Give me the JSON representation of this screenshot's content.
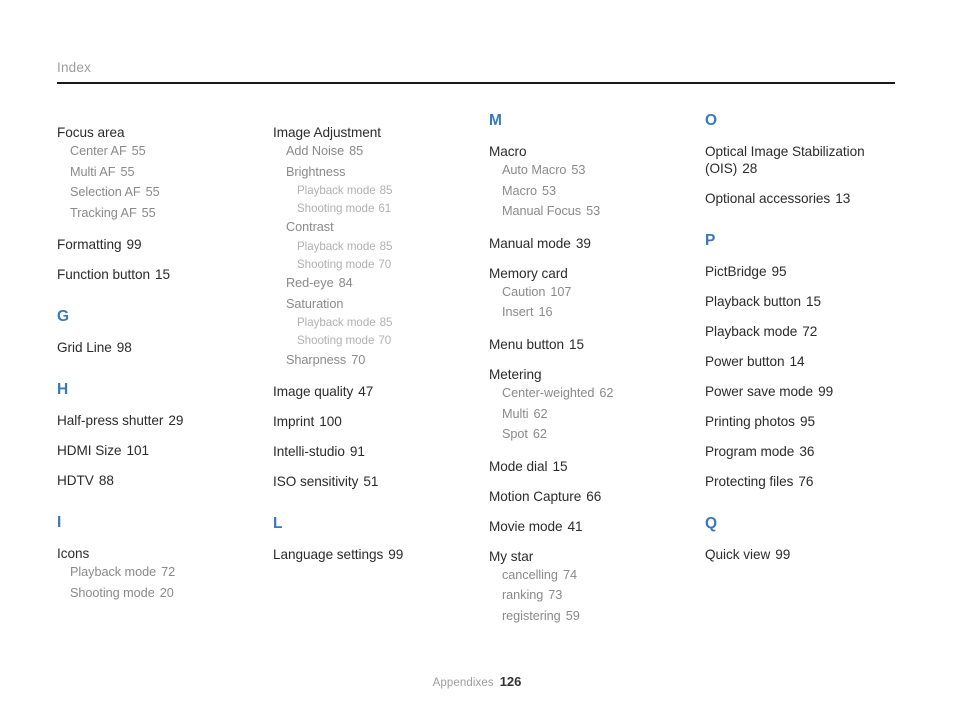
{
  "header": {
    "title": "Index"
  },
  "footer": {
    "label": "Appendixes",
    "page": "126"
  },
  "colors": {
    "section_letter": "#3878c0",
    "level1_text": "#2b2b2b",
    "level2_text": "#8a8a8a",
    "level3_text": "#b1b1b1",
    "header_text": "#9d9d9d",
    "rule": "#1a1a1a",
    "background": "#ffffff"
  },
  "columns": [
    {
      "blocks": [
        {
          "type": "group",
          "term": "Focus area",
          "page": "",
          "children": [
            {
              "term": "Center AF",
              "page": "55"
            },
            {
              "term": "Multi AF",
              "page": "55"
            },
            {
              "term": "Selection AF",
              "page": "55"
            },
            {
              "term": "Tracking AF",
              "page": "55"
            }
          ]
        },
        {
          "type": "entry",
          "term": "Formatting",
          "page": "99"
        },
        {
          "type": "entry",
          "term": "Function button",
          "page": "15"
        },
        {
          "type": "letter",
          "letter": "G"
        },
        {
          "type": "entry",
          "term": "Grid Line",
          "page": "98"
        },
        {
          "type": "letter",
          "letter": "H"
        },
        {
          "type": "entry",
          "term": "Half-press shutter",
          "page": "29"
        },
        {
          "type": "entry",
          "term": "HDMI Size",
          "page": "101"
        },
        {
          "type": "entry",
          "term": "HDTV",
          "page": "88"
        },
        {
          "type": "letter",
          "letter": "I"
        },
        {
          "type": "group",
          "term": "Icons",
          "page": "",
          "children": [
            {
              "term": "Playback mode",
              "page": "72"
            },
            {
              "term": "Shooting mode",
              "page": "20"
            }
          ]
        }
      ]
    },
    {
      "blocks": [
        {
          "type": "group",
          "term": "Image Adjustment",
          "page": "",
          "children": [
            {
              "term": "Add Noise",
              "page": "85"
            },
            {
              "term": "Brightness",
              "page": "",
              "children": [
                {
                  "term": "Playback mode",
                  "page": "85"
                },
                {
                  "term": "Shooting mode",
                  "page": "61"
                }
              ]
            },
            {
              "term": "Contrast",
              "page": "",
              "children": [
                {
                  "term": "Playback mode",
                  "page": "85"
                },
                {
                  "term": "Shooting mode",
                  "page": "70"
                }
              ]
            },
            {
              "term": "Red-eye",
              "page": "84"
            },
            {
              "term": "Saturation",
              "page": "",
              "children": [
                {
                  "term": "Playback mode",
                  "page": "85"
                },
                {
                  "term": "Shooting mode",
                  "page": "70"
                }
              ]
            },
            {
              "term": "Sharpness",
              "page": "70"
            }
          ]
        },
        {
          "type": "entry",
          "term": "Image quality",
          "page": "47"
        },
        {
          "type": "entry",
          "term": "Imprint",
          "page": "100"
        },
        {
          "type": "entry",
          "term": "Intelli-studio",
          "page": "91"
        },
        {
          "type": "entry",
          "term": "ISO sensitivity",
          "page": "51"
        },
        {
          "type": "letter",
          "letter": "L"
        },
        {
          "type": "entry",
          "term": "Language settings",
          "page": "99"
        }
      ]
    },
    {
      "blocks": [
        {
          "type": "letter",
          "letter": "M"
        },
        {
          "type": "group",
          "term": "Macro",
          "page": "",
          "children": [
            {
              "term": "Auto Macro",
              "page": "53"
            },
            {
              "term": "Macro",
              "page": "53"
            },
            {
              "term": "Manual Focus",
              "page": "53"
            }
          ]
        },
        {
          "type": "entry",
          "term": "Manual mode",
          "page": "39"
        },
        {
          "type": "group",
          "term": "Memory card",
          "page": "",
          "children": [
            {
              "term": "Caution",
              "page": "107"
            },
            {
              "term": "Insert",
              "page": "16"
            }
          ]
        },
        {
          "type": "entry",
          "term": "Menu button",
          "page": "15"
        },
        {
          "type": "group",
          "term": "Metering",
          "page": "",
          "children": [
            {
              "term": "Center-weighted",
              "page": "62"
            },
            {
              "term": "Multi",
              "page": "62"
            },
            {
              "term": "Spot",
              "page": "62"
            }
          ]
        },
        {
          "type": "entry",
          "term": "Mode dial",
          "page": "15"
        },
        {
          "type": "entry",
          "term": "Motion Capture",
          "page": "66"
        },
        {
          "type": "entry",
          "term": "Movie mode",
          "page": "41"
        },
        {
          "type": "group",
          "term": "My star",
          "page": "",
          "children": [
            {
              "term": "cancelling",
              "page": "74"
            },
            {
              "term": "ranking",
              "page": "73"
            },
            {
              "term": "registering",
              "page": "59"
            }
          ]
        }
      ]
    },
    {
      "blocks": [
        {
          "type": "letter",
          "letter": "O"
        },
        {
          "type": "entry",
          "term": "Optical Image Stabilization (OIS)",
          "page": "28"
        },
        {
          "type": "entry",
          "term": "Optional accessories",
          "page": "13"
        },
        {
          "type": "letter",
          "letter": "P"
        },
        {
          "type": "entry",
          "term": "PictBridge",
          "page": "95"
        },
        {
          "type": "entry",
          "term": "Playback button",
          "page": "15"
        },
        {
          "type": "entry",
          "term": "Playback mode",
          "page": "72"
        },
        {
          "type": "entry",
          "term": "Power button",
          "page": "14"
        },
        {
          "type": "entry",
          "term": "Power save mode",
          "page": "99"
        },
        {
          "type": "entry",
          "term": "Printing photos",
          "page": "95"
        },
        {
          "type": "entry",
          "term": "Program mode",
          "page": "36"
        },
        {
          "type": "entry",
          "term": "Protecting files",
          "page": "76"
        },
        {
          "type": "letter",
          "letter": "Q"
        },
        {
          "type": "entry",
          "term": "Quick view",
          "page": "99"
        }
      ]
    }
  ]
}
